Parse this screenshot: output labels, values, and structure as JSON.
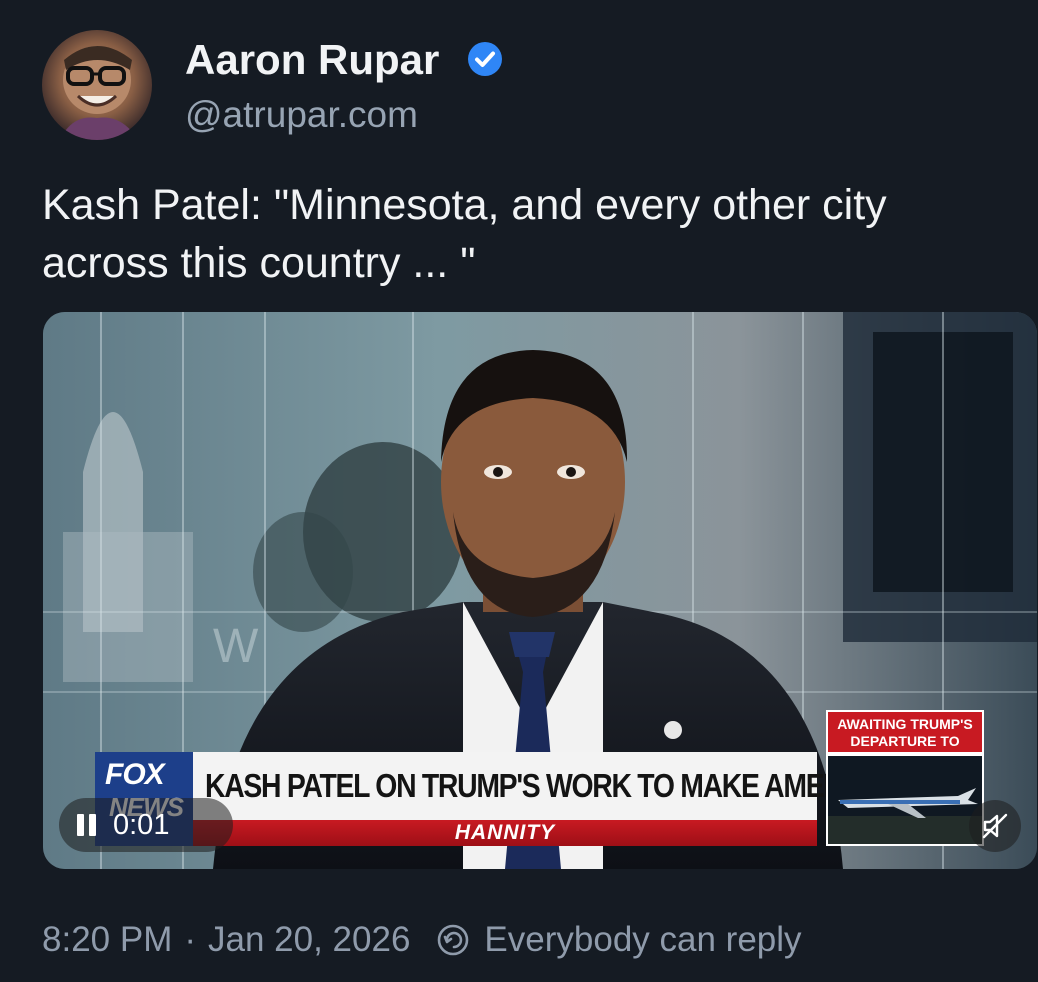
{
  "author": {
    "name": "Aaron Rupar",
    "handle": "@atrupar.com",
    "verified": true,
    "avatar_icon": "avatar"
  },
  "post": {
    "text": "Kash Patel: \"Minnesota, and every other city across this country ... \""
  },
  "video": {
    "chyron_headline": "KASH PATEL ON TRUMP'S WORK TO MAKE AMERICA SAFER",
    "chyron_show": "HANNITY",
    "network_logo_top": "FOX",
    "network_logo_bottom": "NEWS",
    "side_box_caption": "AWAITING TRUMP'S DEPARTURE TO DAVOS",
    "backdrop_text": "WASHIN",
    "elapsed_time": "0:01",
    "play_state_icon": "pause-icon",
    "mute_icon": "muted-speaker-icon"
  },
  "footer": {
    "time": "8:20 PM",
    "separator": "·",
    "date": "Jan 20, 2026",
    "reply_setting": "Everybody can reply",
    "reply_icon": "reply-settings-icon"
  },
  "colors": {
    "background": "#151b23",
    "verified_blue": "#2f86f6",
    "secondary_text": "#8f9bab",
    "fox_red": "#c81a22"
  }
}
